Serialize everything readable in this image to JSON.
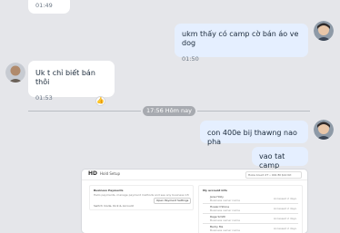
{
  "messages": [
    {
      "text": "",
      "time": "01:49"
    },
    {
      "text": "ukm thấy có camp cờ bán áo ve dog",
      "time": "01:50"
    },
    {
      "text": "Uk t chỉ biết bán thôi",
      "time": "01:53"
    },
    {
      "text": "con 400e bij thawng nao pha"
    },
    {
      "text": "vao tat camp"
    }
  ],
  "divider": {
    "label": "17:56 Hôm nay"
  },
  "screenshot": {
    "logo": "HD",
    "app_title": "Hold Setup",
    "select_label": "Hoka Count 2T • 001 Bt $12 Kit",
    "section1_title": "Business Payments",
    "section1_desc": "Hello payments, manage payment methods and see any business information",
    "section1_link": "Switch mode, Kick & Account",
    "section1_button": "Open Payment Settings",
    "section2_title": "My account info",
    "rows": [
      {
        "name": "Jane Holly",
        "sub": "Business owner name",
        "date": "Accessed 2 days"
      },
      {
        "name": "Howard Stone",
        "sub": "Business owner name",
        "date": "Accessed 2 days"
      },
      {
        "name": "Rage Smith",
        "sub": "Business owner name",
        "date": "Accessed 2 days"
      },
      {
        "name": "Becky Ma",
        "sub": "Business owner name",
        "date": "Accessed 2 days"
      }
    ]
  },
  "colors": {
    "outgoing_bubble": "#e5efff",
    "incoming_bubble": "#ffffff",
    "background": "#e5e6ea"
  }
}
